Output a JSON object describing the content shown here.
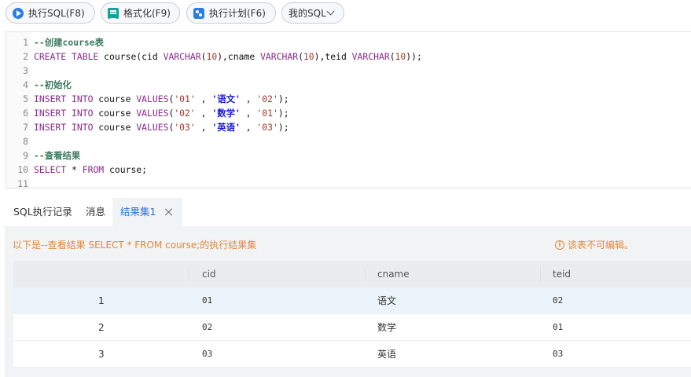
{
  "toolbar": {
    "run_label": "执行SQL(F8)",
    "format_label": "格式化(F9)",
    "plan_label": "执行计划(F6)",
    "mysql_label": "我的SQL"
  },
  "editor": {
    "lines": [
      {
        "n": "1",
        "parts": [
          {
            "t": "--创建course表",
            "c": "cmt"
          }
        ]
      },
      {
        "n": "2",
        "parts": [
          {
            "t": "CREATE TABLE ",
            "c": "kw"
          },
          {
            "t": "course(cid ",
            "c": "pl"
          },
          {
            "t": "VARCHAR",
            "c": "typ"
          },
          {
            "t": "(",
            "c": "pl"
          },
          {
            "t": "10",
            "c": "num"
          },
          {
            "t": "),cname ",
            "c": "pl"
          },
          {
            "t": "VARCHAR",
            "c": "typ"
          },
          {
            "t": "(",
            "c": "pl"
          },
          {
            "t": "10",
            "c": "num"
          },
          {
            "t": "),teid ",
            "c": "pl"
          },
          {
            "t": "VARCHAR",
            "c": "typ"
          },
          {
            "t": "(",
            "c": "pl"
          },
          {
            "t": "10",
            "c": "num"
          },
          {
            "t": "));",
            "c": "pl"
          }
        ]
      },
      {
        "n": "3",
        "parts": []
      },
      {
        "n": "4",
        "parts": [
          {
            "t": "--初始化",
            "c": "cmt"
          }
        ]
      },
      {
        "n": "5",
        "parts": [
          {
            "t": "INSERT INTO ",
            "c": "kw"
          },
          {
            "t": "course ",
            "c": "pl"
          },
          {
            "t": "VALUES",
            "c": "kw"
          },
          {
            "t": "(",
            "c": "pl"
          },
          {
            "t": "'01'",
            "c": "str"
          },
          {
            "t": " , ",
            "c": "pl"
          },
          {
            "t": "'语文'",
            "c": "strb"
          },
          {
            "t": " , ",
            "c": "pl"
          },
          {
            "t": "'02'",
            "c": "str"
          },
          {
            "t": ");",
            "c": "pl"
          }
        ]
      },
      {
        "n": "6",
        "parts": [
          {
            "t": "INSERT INTO ",
            "c": "kw"
          },
          {
            "t": "course ",
            "c": "pl"
          },
          {
            "t": "VALUES",
            "c": "kw"
          },
          {
            "t": "(",
            "c": "pl"
          },
          {
            "t": "'02'",
            "c": "str"
          },
          {
            "t": " , ",
            "c": "pl"
          },
          {
            "t": "'数学'",
            "c": "strb"
          },
          {
            "t": " , ",
            "c": "pl"
          },
          {
            "t": "'01'",
            "c": "str"
          },
          {
            "t": ");",
            "c": "pl"
          }
        ]
      },
      {
        "n": "7",
        "parts": [
          {
            "t": "INSERT INTO ",
            "c": "kw"
          },
          {
            "t": "course ",
            "c": "pl"
          },
          {
            "t": "VALUES",
            "c": "kw"
          },
          {
            "t": "(",
            "c": "pl"
          },
          {
            "t": "'03'",
            "c": "str"
          },
          {
            "t": " , ",
            "c": "pl"
          },
          {
            "t": "'英语'",
            "c": "strb"
          },
          {
            "t": " , ",
            "c": "pl"
          },
          {
            "t": "'03'",
            "c": "str"
          },
          {
            "t": ");",
            "c": "pl"
          }
        ]
      },
      {
        "n": "8",
        "parts": []
      },
      {
        "n": "9",
        "parts": [
          {
            "t": "--查看结果",
            "c": "cmt"
          }
        ]
      },
      {
        "n": "10",
        "parts": [
          {
            "t": "SELECT ",
            "c": "kw"
          },
          {
            "t": "* ",
            "c": "pl"
          },
          {
            "t": "FROM ",
            "c": "kw"
          },
          {
            "t": "course;",
            "c": "pl"
          }
        ]
      },
      {
        "n": "11",
        "parts": []
      }
    ]
  },
  "tabs": {
    "history": "SQL执行记录",
    "messages": "消息",
    "result": "结果集1"
  },
  "result": {
    "notice": "以下是--查看结果 SELECT * FROM course;的执行结果集",
    "readonly": "该表不可编辑。",
    "columns": [
      "",
      "cid",
      "cname",
      "teid"
    ],
    "rows": [
      [
        "1",
        "01",
        "语文",
        "02"
      ],
      [
        "2",
        "02",
        "数学",
        "01"
      ],
      [
        "3",
        "03",
        "英语",
        "03"
      ]
    ]
  },
  "colors": {
    "accent": "#2a6ed8",
    "warning": "#e08a3a"
  }
}
